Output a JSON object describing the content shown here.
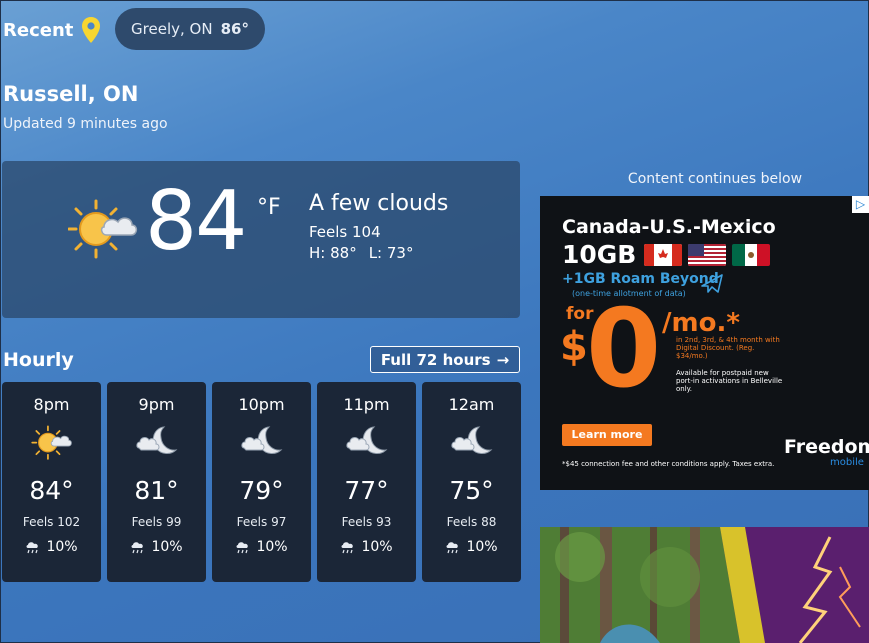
{
  "recent": {
    "label": "Recent",
    "chip_city": "Greely, ON",
    "chip_temp": "86°"
  },
  "location": {
    "name": "Russell, ON",
    "updated": "Updated 9 minutes ago"
  },
  "current": {
    "temp": "84",
    "unit": "°F",
    "condition": "A few clouds",
    "feels": "Feels 104",
    "high": "H: 88°",
    "low": "L: 73°",
    "icon": "sun-cloud-icon"
  },
  "hourly": {
    "title": "Hourly",
    "full_button": "Full 72 hours",
    "hours": [
      {
        "time": "8pm",
        "icon": "sun-cloud-icon",
        "temp": "84°",
        "feels": "Feels 102",
        "precip": "10%"
      },
      {
        "time": "9pm",
        "icon": "moon-cloud-icon",
        "temp": "81°",
        "feels": "Feels 99",
        "precip": "10%"
      },
      {
        "time": "10pm",
        "icon": "moon-cloud-icon",
        "temp": "79°",
        "feels": "Feels 97",
        "precip": "10%"
      },
      {
        "time": "11pm",
        "icon": "moon-cloud-icon",
        "temp": "77°",
        "feels": "Feels 93",
        "precip": "10%"
      },
      {
        "time": "12am",
        "icon": "moon-cloud-icon",
        "temp": "75°",
        "feels": "Feels 88",
        "precip": "10%"
      }
    ]
  },
  "ad": {
    "note": "Content continues below",
    "headline": "Canada-U.S.-Mexico",
    "data": "10GB",
    "roam": "+1GB Roam Beyond",
    "roam_sub": "(one-time allotment of data)",
    "for": "for",
    "dollar": "$",
    "price": "0",
    "per": "/mo.*",
    "discount_note": "in 2nd, 3rd, & 4th month with Digital Discount. (Reg. $34/mo.)",
    "availability": "Available for postpaid new port-in activations in Belleville only.",
    "button": "Learn more",
    "brand": "Freedom",
    "brand_sub": "mobile",
    "fine_print": "*$45 connection fee and other conditions apply. Taxes extra.",
    "colors": {
      "accent": "#f47920",
      "blue": "#3ea1df",
      "bg": "#0f1216"
    }
  }
}
